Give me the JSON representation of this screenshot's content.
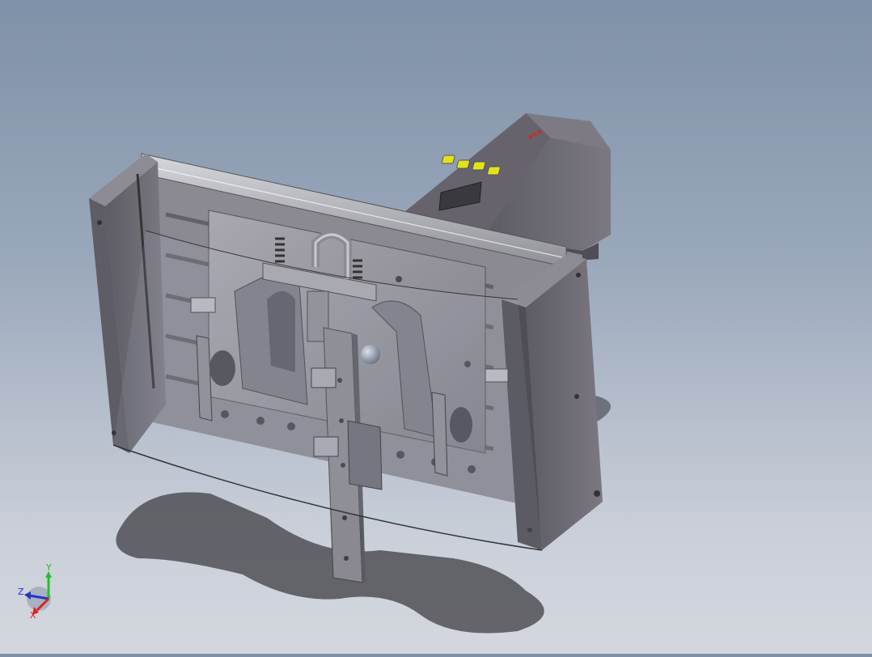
{
  "viewport": {
    "background_top": "#7f91a8",
    "background_bottom": "#d4d7de",
    "model_colors": {
      "body": "#6f6c76",
      "body_dark": "#4f4d55",
      "rail": "#b7b8be",
      "plate": "#9a98a0",
      "accent_yellow": "#e3e21a",
      "accent_red": "#c0322b",
      "shadow": "#3f3f44"
    }
  },
  "triad": {
    "x_label": "X",
    "y_label": "Y",
    "z_label": "Z",
    "x_color": "#d8231f",
    "y_color": "#22c02a",
    "z_color": "#2236c8"
  },
  "icons": {
    "orientation_triad": "axis-triad-icon"
  }
}
